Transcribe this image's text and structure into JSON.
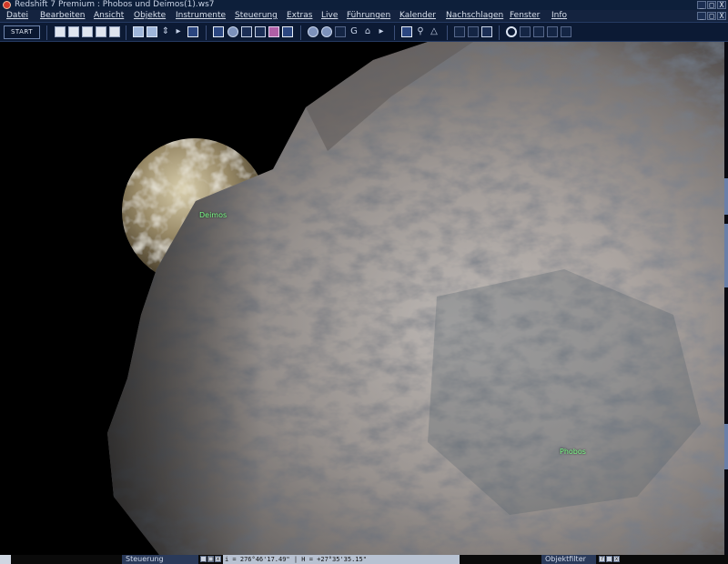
{
  "window": {
    "title": "Redshift 7 Premium : Phobos und Deimos(1).ws7",
    "controls": [
      "_",
      "□",
      "X"
    ],
    "mdi_controls": [
      "_",
      "□",
      "X"
    ]
  },
  "menu": [
    "Datei",
    "Bearbeiten",
    "Ansicht",
    "Objekte",
    "Instrumente",
    "Steuerung",
    "Extras",
    "Live",
    "Führungen",
    "Kalender",
    "Nachschlagen",
    "Fenster",
    "Info"
  ],
  "toolbar": {
    "start_label": "START",
    "icons": [
      "new-document-icon",
      "open-folder-icon",
      "save-icon",
      "print-icon",
      "export-icon",
      "monitor-icon",
      "window-icon",
      "fullscreen-icon",
      "playback-icon",
      "screen-icon",
      "window-grid-icon",
      "globe-icon",
      "panel-icon",
      "panel-icon",
      "pink-panel-icon",
      "zoom-box-icon",
      "earth-icon",
      "rotate-icon",
      "target-icon",
      "g-icon",
      "home-icon",
      "flag-icon",
      "focus-icon",
      "magnify-icon",
      "triangle-icon",
      "link-icon",
      "grid-icon",
      "image-icon",
      "record-icon",
      "doc-icon",
      "back-icon",
      "h-icon",
      "page-icon"
    ]
  },
  "scene": {
    "labels": {
      "deimos": "Deimos",
      "phobos": "Phobos"
    },
    "label_color": "#7dff8a"
  },
  "bottom": {
    "left_panel": "Steuerung",
    "coords": "i = 276°46'17.49\" | H = +27°35'35.15\"",
    "right_panel": "Objektfilter"
  }
}
